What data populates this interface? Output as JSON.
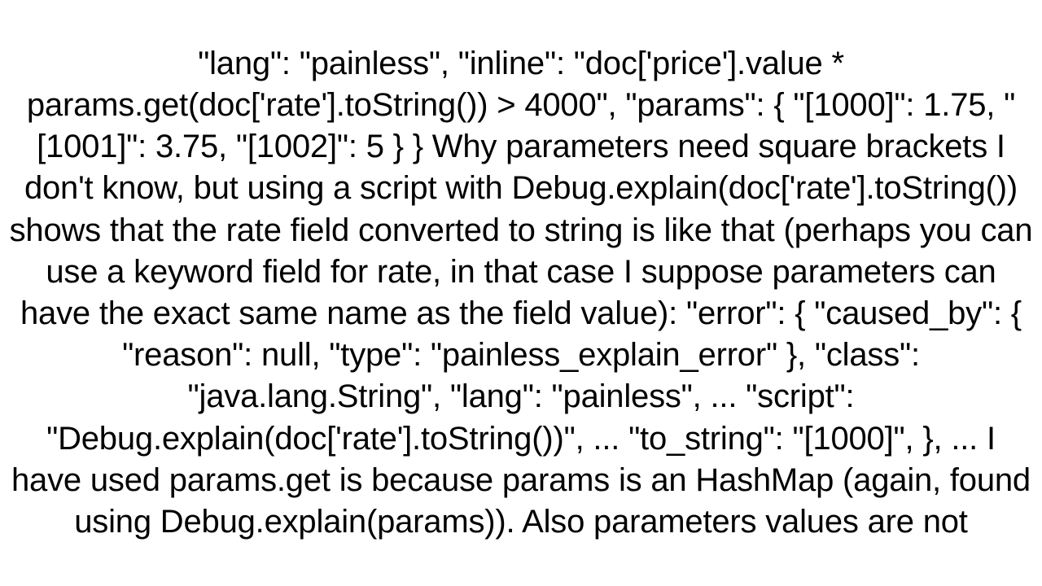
{
  "document": {
    "text": "\"lang\": \"painless\",     \"inline\": \"doc['price'].value * params.get(doc['rate'].toString()) > 4000\",     \"params\": {         \"[1000]\": 1.75,         \"[1001]\": 3.75,         \"[1002]\": 5     } }  Why parameters need square brackets I don't know, but using a script with Debug.explain(doc['rate'].toString()) shows that the rate field converted to string is like that (perhaps you can use a keyword field for rate, in that case I suppose parameters can have the exact same name as the field value): \"error\": {     \"caused_by\": {         \"reason\": null,         \"type\": \"painless_explain_error\"     },     \"class\": \"java.lang.String\",     \"lang\": \"painless\",     ...     \"script\": \"Debug.explain(doc['rate'].toString())\",     ...     \"to_string\": \"[1000]\", }, ...  I have used params.get is because params is an HashMap (again, found using Debug.explain(params)). Also parameters values are not"
  }
}
